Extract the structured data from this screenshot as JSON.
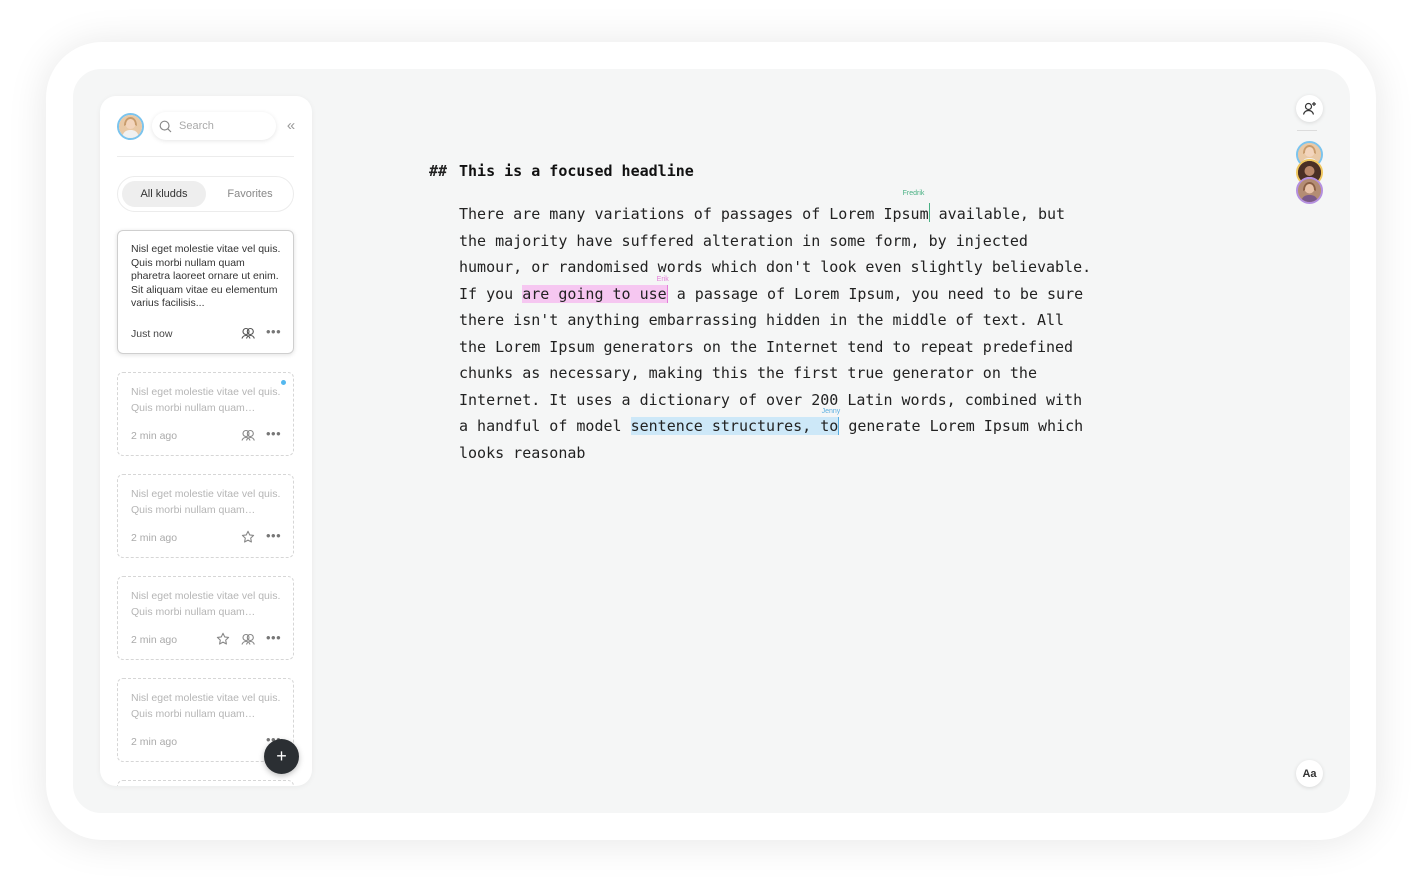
{
  "sidebar": {
    "search": {
      "placeholder": "Search"
    },
    "collapse_icon": "«",
    "tabs": [
      {
        "label": "All kludds",
        "active": true
      },
      {
        "label": "Favorites",
        "active": false
      }
    ],
    "cards": [
      {
        "text": "Nisl eget molestie vitae vel quis. Quis morbi nullam quam pharetra laoreet ornare ut enim. Sit aliquam vitae eu elementum varius facilisis...",
        "time": "Just now",
        "icons": [
          "collaborators-icon",
          "more-icon"
        ]
      },
      {
        "text": "Nisl eget molestie vitae vel quis. Quis morbi nullam quam pharetra",
        "time": "2 min ago",
        "icons": [
          "collaborators-icon",
          "more-icon"
        ],
        "unread": true
      },
      {
        "text": "Nisl eget molestie vitae vel quis. Quis morbi nullam quam pharetra",
        "time": "2 min ago",
        "icons": [
          "star-icon",
          "more-icon"
        ]
      },
      {
        "text": "Nisl eget molestie vitae vel quis. Quis morbi nullam quam pharetra",
        "time": "2 min ago",
        "icons": [
          "star-icon",
          "collaborators-icon",
          "more-icon"
        ]
      },
      {
        "text": "Nisl eget molestie vitae vel quis. Quis morbi nullam quam pharetra",
        "time": "2 min ago",
        "icons": [
          "more-icon"
        ]
      }
    ],
    "fab_label": "+"
  },
  "editor": {
    "heading_marker": "##",
    "headline": "This is a focused headline",
    "body": {
      "p1": "There are many variations of passages of Lorem Ipsum",
      "p2": " available, but\nthe majority have suffered alteration in some form, by injected\nhumour, or randomised words which don't look even slightly believable.\nIf you ",
      "highlight_erik": "are going to use",
      "p3": " a passage of Lorem Ipsum, you need to be sure\nthere isn't anything embarrassing hidden in the middle of text. All\nthe Lorem Ipsum generators on the Internet tend to repeat predefined\nchunks as necessary, making this the first true generator on the\nInternet. It uses a dictionary of over 200 Latin words, combined with\na handful of model ",
      "highlight_jenny": "sentence structures, to",
      "p4": " generate Lorem Ipsum which\nlooks reasonab"
    },
    "cursors": {
      "fredrik": "Fredrik",
      "erik": "Erik",
      "jenny": "Jenny"
    }
  },
  "right_panel": {
    "add_collaborator_icon": "add-user-icon",
    "font_button_label": "Aa"
  },
  "colors": {
    "erik_highlight": "#f6c7f1",
    "jenny_highlight": "#cde8f8",
    "fredrik_cursor": "#48b083",
    "unread_dot": "#54b8ef",
    "fab": "#2b2f33"
  }
}
